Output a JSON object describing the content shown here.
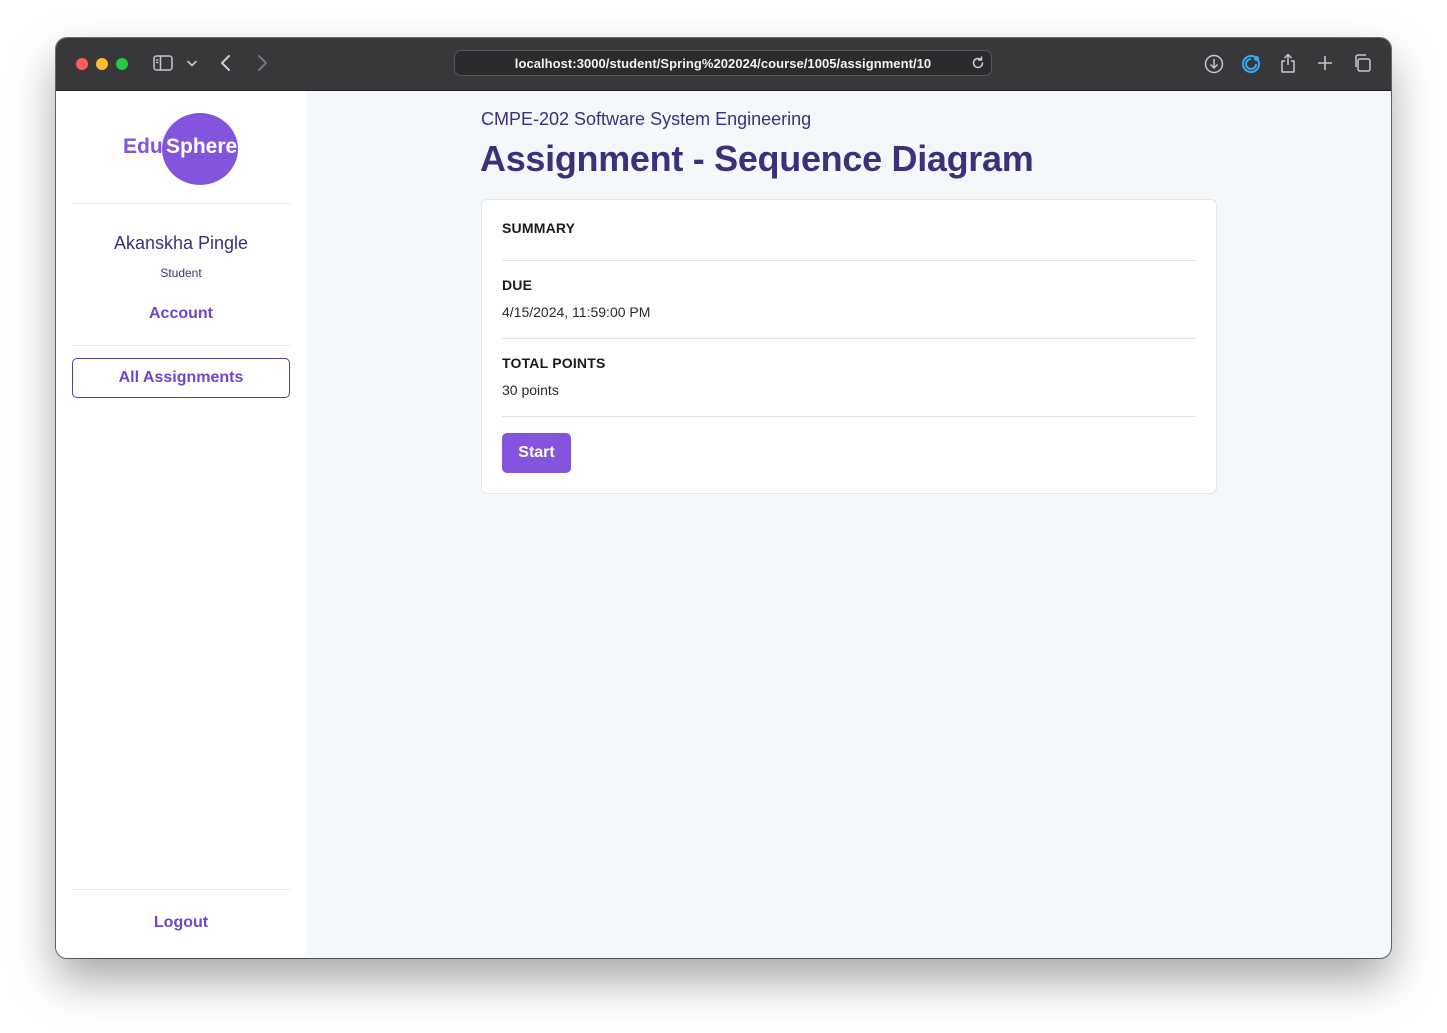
{
  "browser": {
    "url": "localhost:3000/student/Spring%202024/course/1005/assignment/10",
    "traffic_lights": {
      "close": "#fe5f57",
      "minimize": "#febc2e",
      "zoom": "#28c840"
    },
    "icons": {
      "sidebar_toggle": "sidebar-icon",
      "sidebar_menu": "chevron-down-icon",
      "back": "chevron-left-icon",
      "forward": "chevron-right-icon",
      "reload": "reload-icon",
      "downloads": "download-icon",
      "extension": "extension-icon",
      "share": "share-icon",
      "new_tab": "plus-icon",
      "tab_overview": "tabs-icon"
    }
  },
  "sidebar": {
    "logo": {
      "part1": "Edu",
      "part2": "Sphere",
      "color": "#8255dc"
    },
    "user": {
      "name": "Akanskha Pingle",
      "role": "Student"
    },
    "account_label": "Account",
    "nav": {
      "all_assignments": "All Assignments"
    },
    "logout_label": "Logout"
  },
  "main": {
    "course": "CMPE-202 Software System Engineering",
    "title": "Assignment - Sequence Diagram",
    "summary_label": "SUMMARY",
    "due_label": "DUE",
    "due_value": "4/15/2024, 11:59:00 PM",
    "points_label": "TOTAL POINTS",
    "points_value": "30 points",
    "start_label": "Start"
  },
  "colors": {
    "accent": "#8255dc",
    "heading": "#3d2f7a",
    "link": "#6f45c9",
    "main_bg": "#f5f8fb"
  }
}
